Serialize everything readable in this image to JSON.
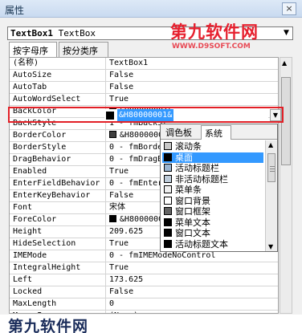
{
  "window": {
    "title": "属性",
    "close_glyph": "×"
  },
  "object_selector": {
    "name": "TextBox1",
    "type": "TextBox"
  },
  "watermark": {
    "line1": "第九软件网",
    "line2": "WWW.D9SOFT.COM"
  },
  "tabs": [
    "按字母序",
    "按分类序"
  ],
  "properties": [
    {
      "name": "(名称)",
      "value": "TextBox1"
    },
    {
      "name": "AutoSize",
      "value": "False"
    },
    {
      "name": "AutoTab",
      "value": "False"
    },
    {
      "name": "AutoWordSelect",
      "value": "True"
    },
    {
      "name": "BackColor",
      "value": "&H80000001&",
      "swatch": "#000000",
      "selected": true
    },
    {
      "name": "BackStyle",
      "value": "1 - fmBackSt"
    },
    {
      "name": "BorderColor",
      "value": "&H8000000",
      "swatch": "#404040"
    },
    {
      "name": "BorderStyle",
      "value": "0 - fmBorde"
    },
    {
      "name": "DragBehavior",
      "value": "0 - fmDragB"
    },
    {
      "name": "Enabled",
      "value": "True"
    },
    {
      "name": "EnterFieldBehavior",
      "value": "0 - fmEnter"
    },
    {
      "name": "EnterKeyBehavior",
      "value": "False"
    },
    {
      "name": "Font",
      "value": "宋体"
    },
    {
      "name": "ForeColor",
      "value": "&H8000000",
      "swatch": "#000000"
    },
    {
      "name": "Height",
      "value": "209.625"
    },
    {
      "name": "HideSelection",
      "value": "True"
    },
    {
      "name": "IMEMode",
      "value": "0 - fmIMEModeNoControl"
    },
    {
      "name": "IntegralHeight",
      "value": "True"
    },
    {
      "name": "Left",
      "value": "173.625"
    },
    {
      "name": "Locked",
      "value": "False"
    },
    {
      "name": "MaxLength",
      "value": "0"
    },
    {
      "name": "MouseIcon",
      "value": "(None)"
    }
  ],
  "color_popup": {
    "tabs": [
      "调色板",
      "系统"
    ],
    "items": [
      {
        "label": "滚动条",
        "color": "#c8c8c8"
      },
      {
        "label": "桌面",
        "color": "#000000",
        "selected": true
      },
      {
        "label": "活动标题栏",
        "color": "#99b4d1"
      },
      {
        "label": "非活动标题栏",
        "color": "#bfcddb"
      },
      {
        "label": "菜单条",
        "color": "#f0f0f0"
      },
      {
        "label": "窗口背景",
        "color": "#ffffff"
      },
      {
        "label": "窗口框架",
        "color": "#646464"
      },
      {
        "label": "菜单文本",
        "color": "#000000"
      },
      {
        "label": "窗口文本",
        "color": "#000000"
      },
      {
        "label": "活动标题文本",
        "color": "#000000"
      }
    ]
  },
  "bottom_watermark": "第九软件网"
}
